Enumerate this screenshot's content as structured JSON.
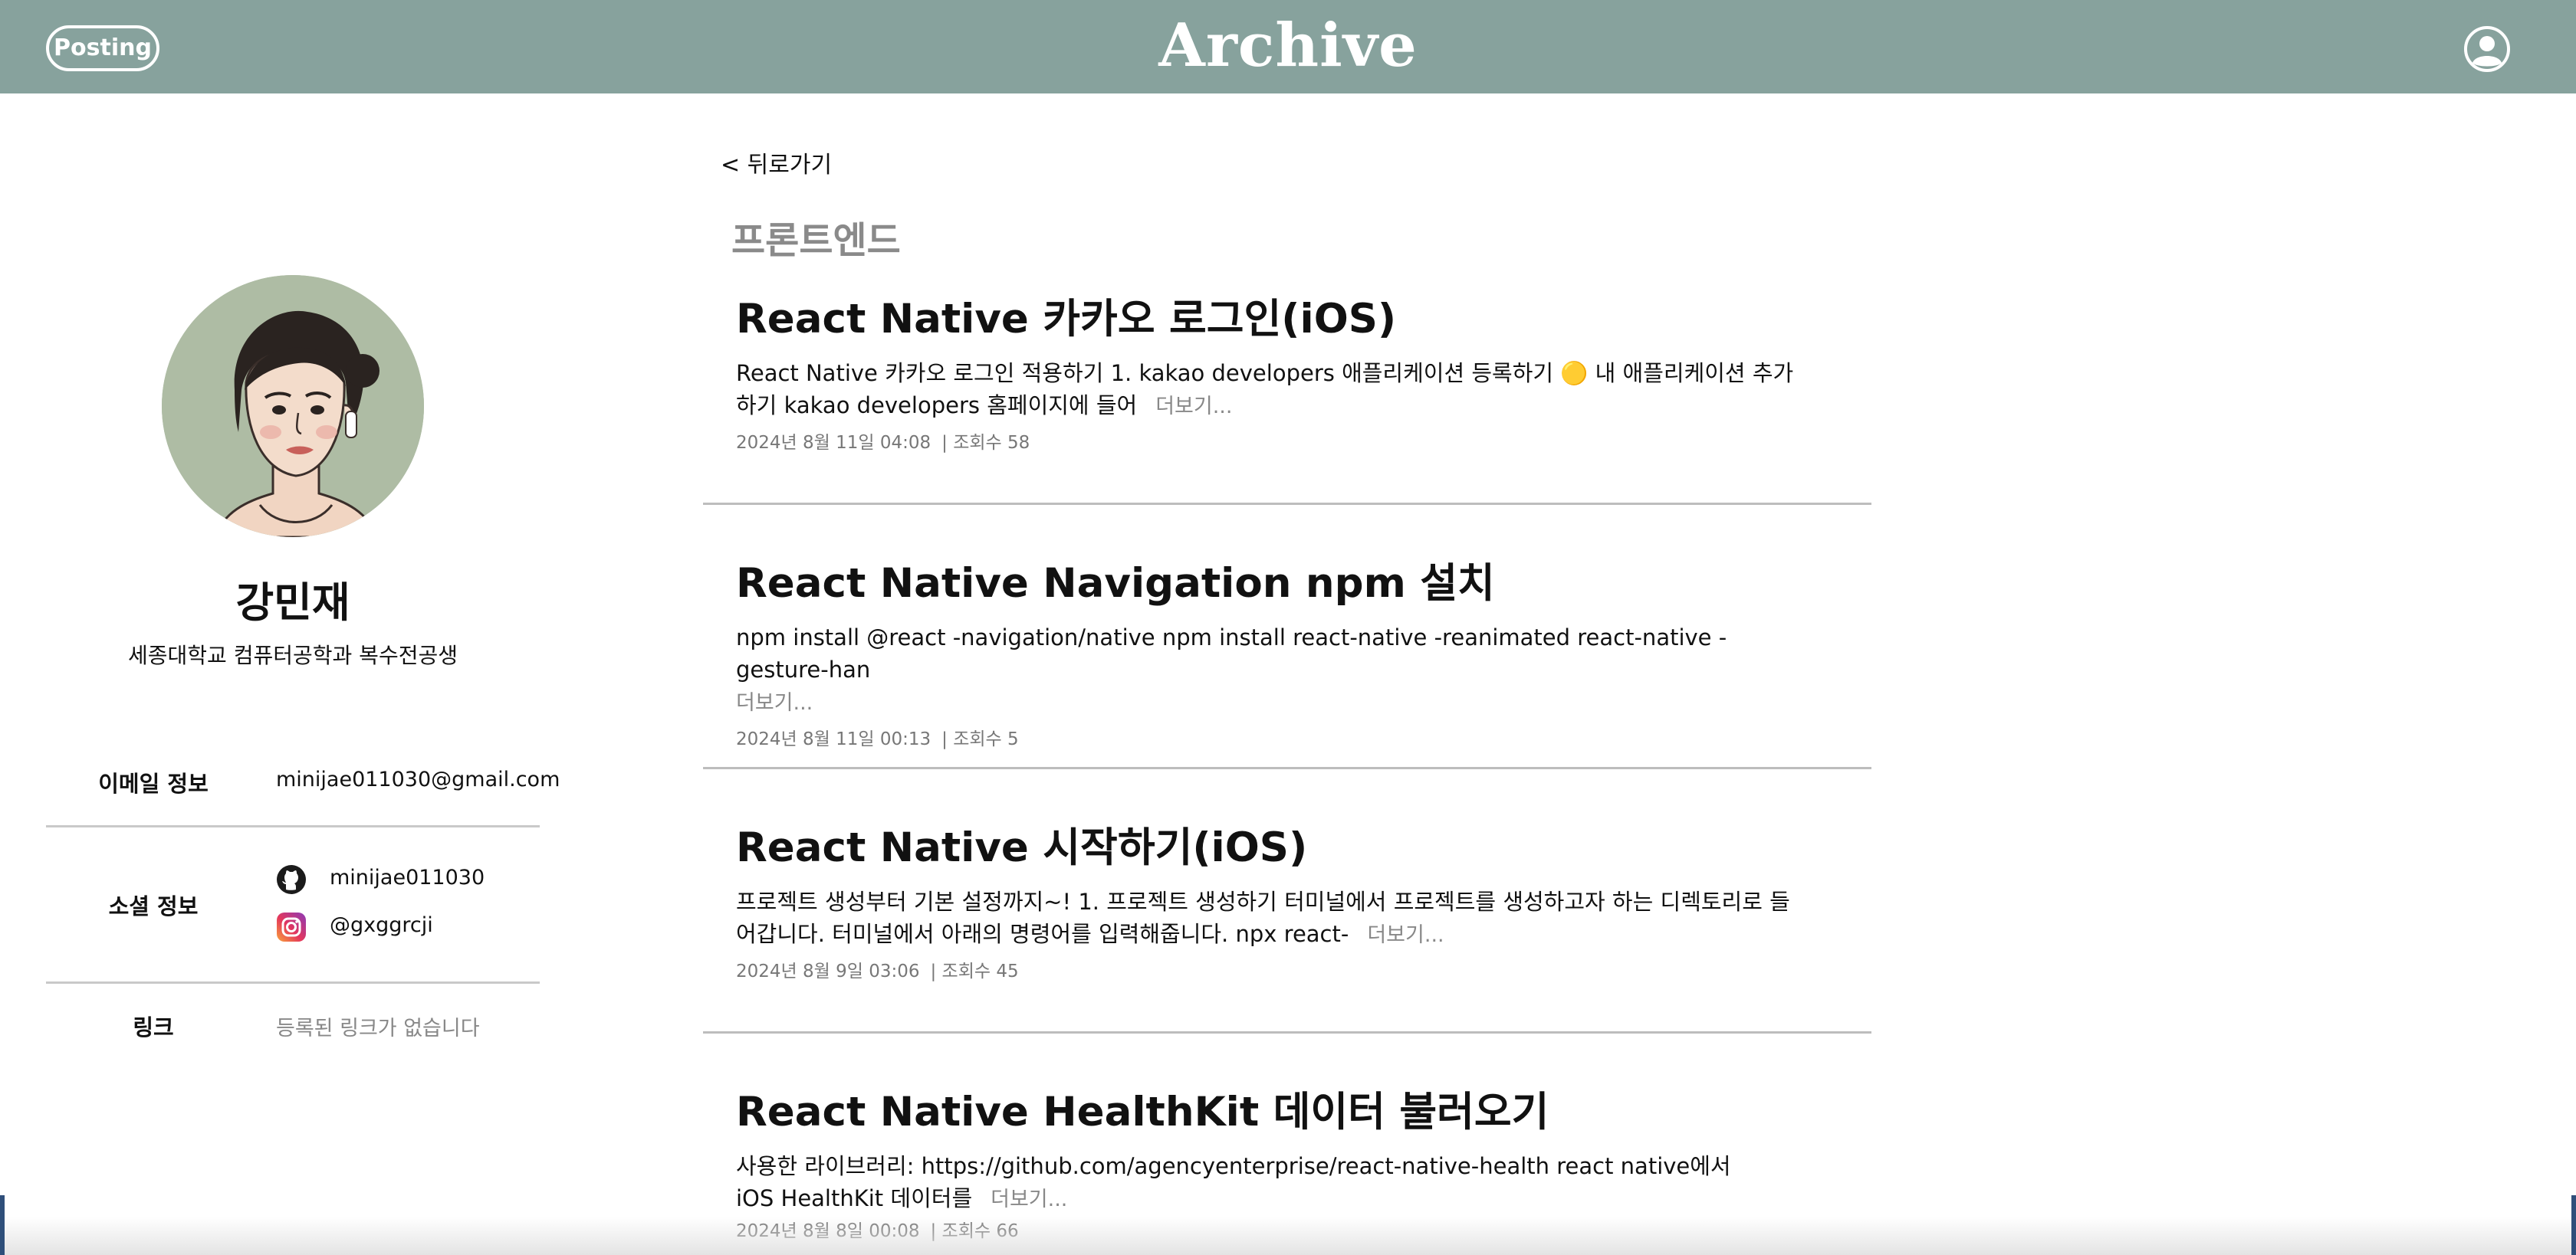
{
  "header": {
    "posting_label": "Posting",
    "site_title": "Archive",
    "profile_icon": "user-circle-icon"
  },
  "profile": {
    "name": "강민재",
    "description": "세종대학교 컴퓨터공학과 복수전공생",
    "avatar_icon": "illustrated-portrait",
    "email": {
      "label": "이메일 정보",
      "value": "minijae011030@gmail.com"
    },
    "social": {
      "label": "소셜 정보",
      "github": {
        "icon": "github-icon",
        "handle": "minijae011030"
      },
      "instagram": {
        "icon": "instagram-icon",
        "handle": "@gxggrcji"
      }
    },
    "links": {
      "label": "링크",
      "empty_text": "등록된 링크가 없습니다"
    }
  },
  "main": {
    "back_label": "< 뒤로가기",
    "category": "프론트엔드",
    "more_label": "더보기...",
    "posts": [
      {
        "title": "React Native 카카오 로그인(iOS)",
        "excerpt": "React Native 카카오 로그인 적용하기 1. kakao developers 애플리케이션 등록하기 🟡 내 애플리케이션 추가하기 kakao developers 홈페이지에 들어",
        "date": "2024년 8월 11일 04:08",
        "views": "| 조회수 58"
      },
      {
        "title": "React Native Navigation npm 설치",
        "excerpt": "npm install @react -navigation/native npm install react-native -reanimated react-native -gesture-han",
        "date": "2024년 8월 11일 00:13",
        "views": "| 조회수 5"
      },
      {
        "title": "React Native 시작하기(iOS)",
        "excerpt": "프로젝트 생성부터 기본 설정까지~! 1. 프로젝트 생성하기 터미널에서 프로젝트를 생성하고자 하는 디렉토리로 들어갑니다. 터미널에서 아래의 명령어를 입력해줍니다. npx react-",
        "date": "2024년 8월 9일 03:06",
        "views": "| 조회수 45"
      },
      {
        "title": "React Native HealthKit 데이터 불러오기",
        "excerpt": "사용한 라이브러리: https://github.com/agencyenterprise/react-native-health react native에서 iOS HealthKit 데이터를",
        "date": "2024년 8월 8일 00:08",
        "views": "| 조회수 66"
      }
    ]
  },
  "colors": {
    "header_bg": "#87a29d",
    "avatar_bg": "#aebca4",
    "muted_text": "#888888",
    "divider": "#bdbdbd"
  }
}
